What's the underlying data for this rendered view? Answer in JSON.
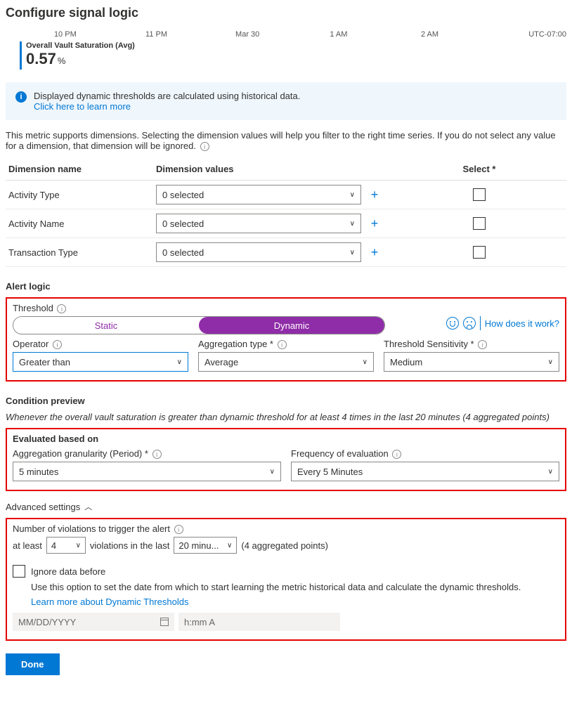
{
  "title": "Configure signal logic",
  "timeline": {
    "t0": "10 PM",
    "t1": "11 PM",
    "t2": "Mar 30",
    "t3": "1 AM",
    "t4": "2 AM",
    "tz": "UTC-07:00"
  },
  "metric": {
    "name": "Overall Vault Saturation (Avg)",
    "value": "0.57",
    "unit": "%"
  },
  "banner": {
    "text": "Displayed dynamic thresholds are calculated using historical data.",
    "link": "Click here to learn more"
  },
  "dimensions": {
    "intro": "This metric supports dimensions. Selecting the dimension values will help you filter to the right time series. If you do not select any value for a dimension, that dimension will be ignored.",
    "headers": {
      "name": "Dimension name",
      "values": "Dimension values",
      "select": "Select *"
    },
    "rows": [
      {
        "name": "Activity Type",
        "value": "0 selected"
      },
      {
        "name": "Activity Name",
        "value": "0 selected"
      },
      {
        "name": "Transaction Type",
        "value": "0 selected"
      }
    ]
  },
  "alert_logic": {
    "heading": "Alert logic",
    "threshold_label": "Threshold",
    "static": "Static",
    "dynamic": "Dynamic",
    "how_link": "How does it work?",
    "operator": {
      "label": "Operator",
      "value": "Greater than"
    },
    "agg_type": {
      "label": "Aggregation type *",
      "value": "Average"
    },
    "sensitivity": {
      "label": "Threshold Sensitivity *",
      "value": "Medium"
    }
  },
  "preview": {
    "heading": "Condition preview",
    "text": "Whenever the overall vault saturation is greater than dynamic threshold for at least 4 times in the last 20 minutes (4 aggregated points)"
  },
  "evaluated": {
    "heading": "Evaluated based on",
    "granularity": {
      "label": "Aggregation granularity (Period) *",
      "value": "5 minutes"
    },
    "frequency": {
      "label": "Frequency of evaluation",
      "value": "Every 5 Minutes"
    }
  },
  "advanced": {
    "toggle": "Advanced settings",
    "violations_label": "Number of violations to trigger the alert",
    "at_least": "at least",
    "violations_count": "4",
    "violations_mid": "violations in the last",
    "violations_window": "20 minu...",
    "aggregated_note": "(4 aggregated points)",
    "ignore_label": "Ignore data before",
    "ignore_desc": "Use this option to set the date from which to start learning the metric historical data and calculate the dynamic thresholds.",
    "learn_link": "Learn more about Dynamic Thresholds",
    "date_placeholder": "MM/DD/YYYY",
    "time_placeholder": "h:mm A"
  },
  "done": "Done"
}
